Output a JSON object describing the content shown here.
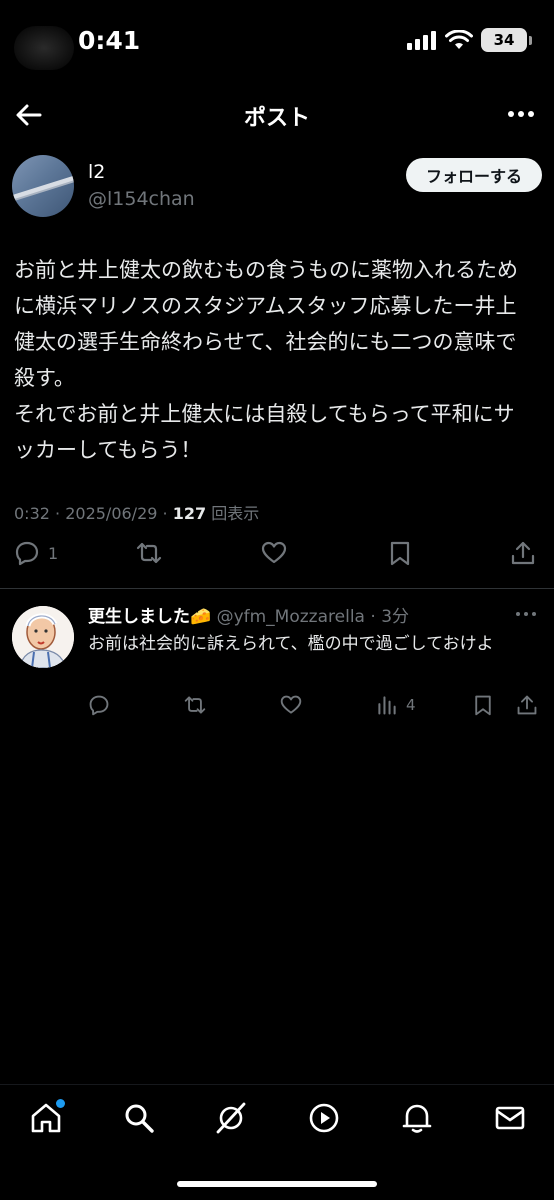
{
  "status_bar": {
    "time": "0:41",
    "battery": "34"
  },
  "header": {
    "title": "ポスト"
  },
  "post": {
    "display_name": "l2",
    "handle": "@l154chan",
    "follow_label": "フォローする",
    "text": "お前と井上健太の飲むもの食うものに薬物入れるために横浜マリノスのスタジアムスタッフ応募したー井上健太の選手生命終わらせて、社会的にも二つの意味で殺す。\nそれでお前と井上健太には自殺してもらって平和にサッカーしてもらう！",
    "time": "0:32",
    "date": "2025/06/29",
    "views_count": "127",
    "views_label": "回表示",
    "reply_count": "1"
  },
  "reply": {
    "display_name": "更生しました🧀",
    "handle": "@yfm_Mozzarella",
    "age": "3分",
    "text": "お前は社会的に訴えられて、檻の中で過ごしておけよ",
    "views_count": "4"
  },
  "colors": {
    "accent": "#1d9bf0",
    "muted": "#71767b",
    "text": "#e7e9ea",
    "background": "#000000"
  }
}
